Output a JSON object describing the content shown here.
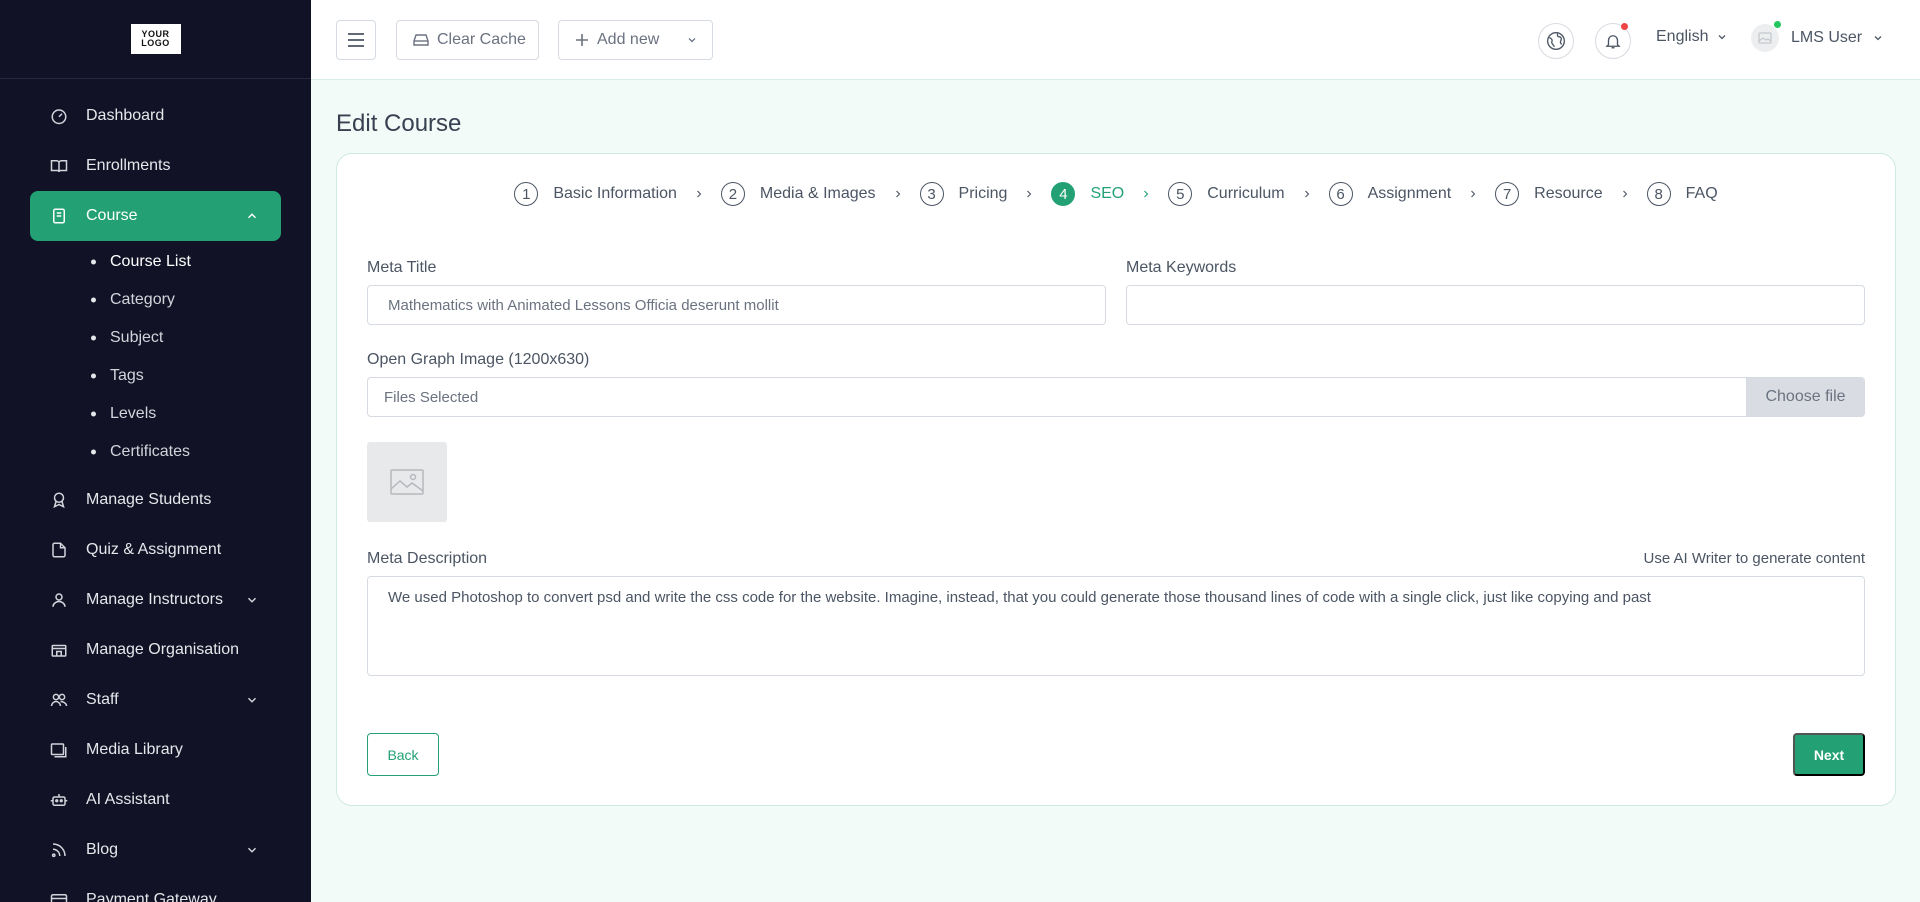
{
  "brand": {
    "logo_line1": "YOUR",
    "logo_line2": "LOGO"
  },
  "colors": {
    "accent": "#23a174",
    "sidebar_bg": "#111225",
    "page_bg": "#f3fbf8",
    "notification": "#ef4444",
    "online": "#22c55e"
  },
  "sidebar": {
    "items": [
      {
        "label": "Dashboard",
        "icon": "gauge-icon"
      },
      {
        "label": "Enrollments",
        "icon": "book-open-icon"
      },
      {
        "label": "Course",
        "icon": "document-icon",
        "active": true,
        "expanded": true
      },
      {
        "label": "Manage Students",
        "icon": "badge-icon"
      },
      {
        "label": "Quiz & Assignment",
        "icon": "file-icon"
      },
      {
        "label": "Manage Instructors",
        "icon": "user-icon",
        "has_children": true
      },
      {
        "label": "Manage Organisation",
        "icon": "building-icon"
      },
      {
        "label": "Staff",
        "icon": "users-icon",
        "has_children": true
      },
      {
        "label": "Media Library",
        "icon": "images-icon"
      },
      {
        "label": "AI Assistant",
        "icon": "robot-icon"
      },
      {
        "label": "Blog",
        "icon": "rss-icon",
        "has_children": true
      },
      {
        "label": "Payment Gateway",
        "icon": "credit-card-icon"
      }
    ],
    "course_sub": [
      {
        "label": "Course List",
        "current": true
      },
      {
        "label": "Category"
      },
      {
        "label": "Subject"
      },
      {
        "label": "Tags"
      },
      {
        "label": "Levels"
      },
      {
        "label": "Certificates"
      }
    ]
  },
  "header": {
    "clear_cache": "Clear Cache",
    "add_new": "Add new",
    "language": "English",
    "user_name": "LMS User"
  },
  "page": {
    "title": "Edit Course"
  },
  "steps": [
    {
      "num": "1",
      "label": "Basic Information"
    },
    {
      "num": "2",
      "label": "Media & Images"
    },
    {
      "num": "3",
      "label": "Pricing"
    },
    {
      "num": "4",
      "label": "SEO",
      "active": true
    },
    {
      "num": "5",
      "label": "Curriculum"
    },
    {
      "num": "6",
      "label": "Assignment"
    },
    {
      "num": "7",
      "label": "Resource"
    },
    {
      "num": "8",
      "label": "FAQ"
    }
  ],
  "form": {
    "meta_title_label": "Meta Title",
    "meta_title_value": "Mathematics with Animated Lessons Officia deserunt mollit",
    "meta_keywords_label": "Meta Keywords",
    "meta_keywords_value": "",
    "og_label": "Open Graph Image (1200x630)",
    "og_file_text": "Files Selected",
    "og_choose": "Choose file",
    "meta_desc_label": "Meta Description",
    "ai_writer": "Use AI Writer to generate content",
    "meta_desc_value": "We used Photoshop to convert psd and write the css code for the website. Imagine, instead, that you could generate those thousand lines of code with a single click, just like copying and past"
  },
  "actions": {
    "back": "Back",
    "next": "Next"
  }
}
